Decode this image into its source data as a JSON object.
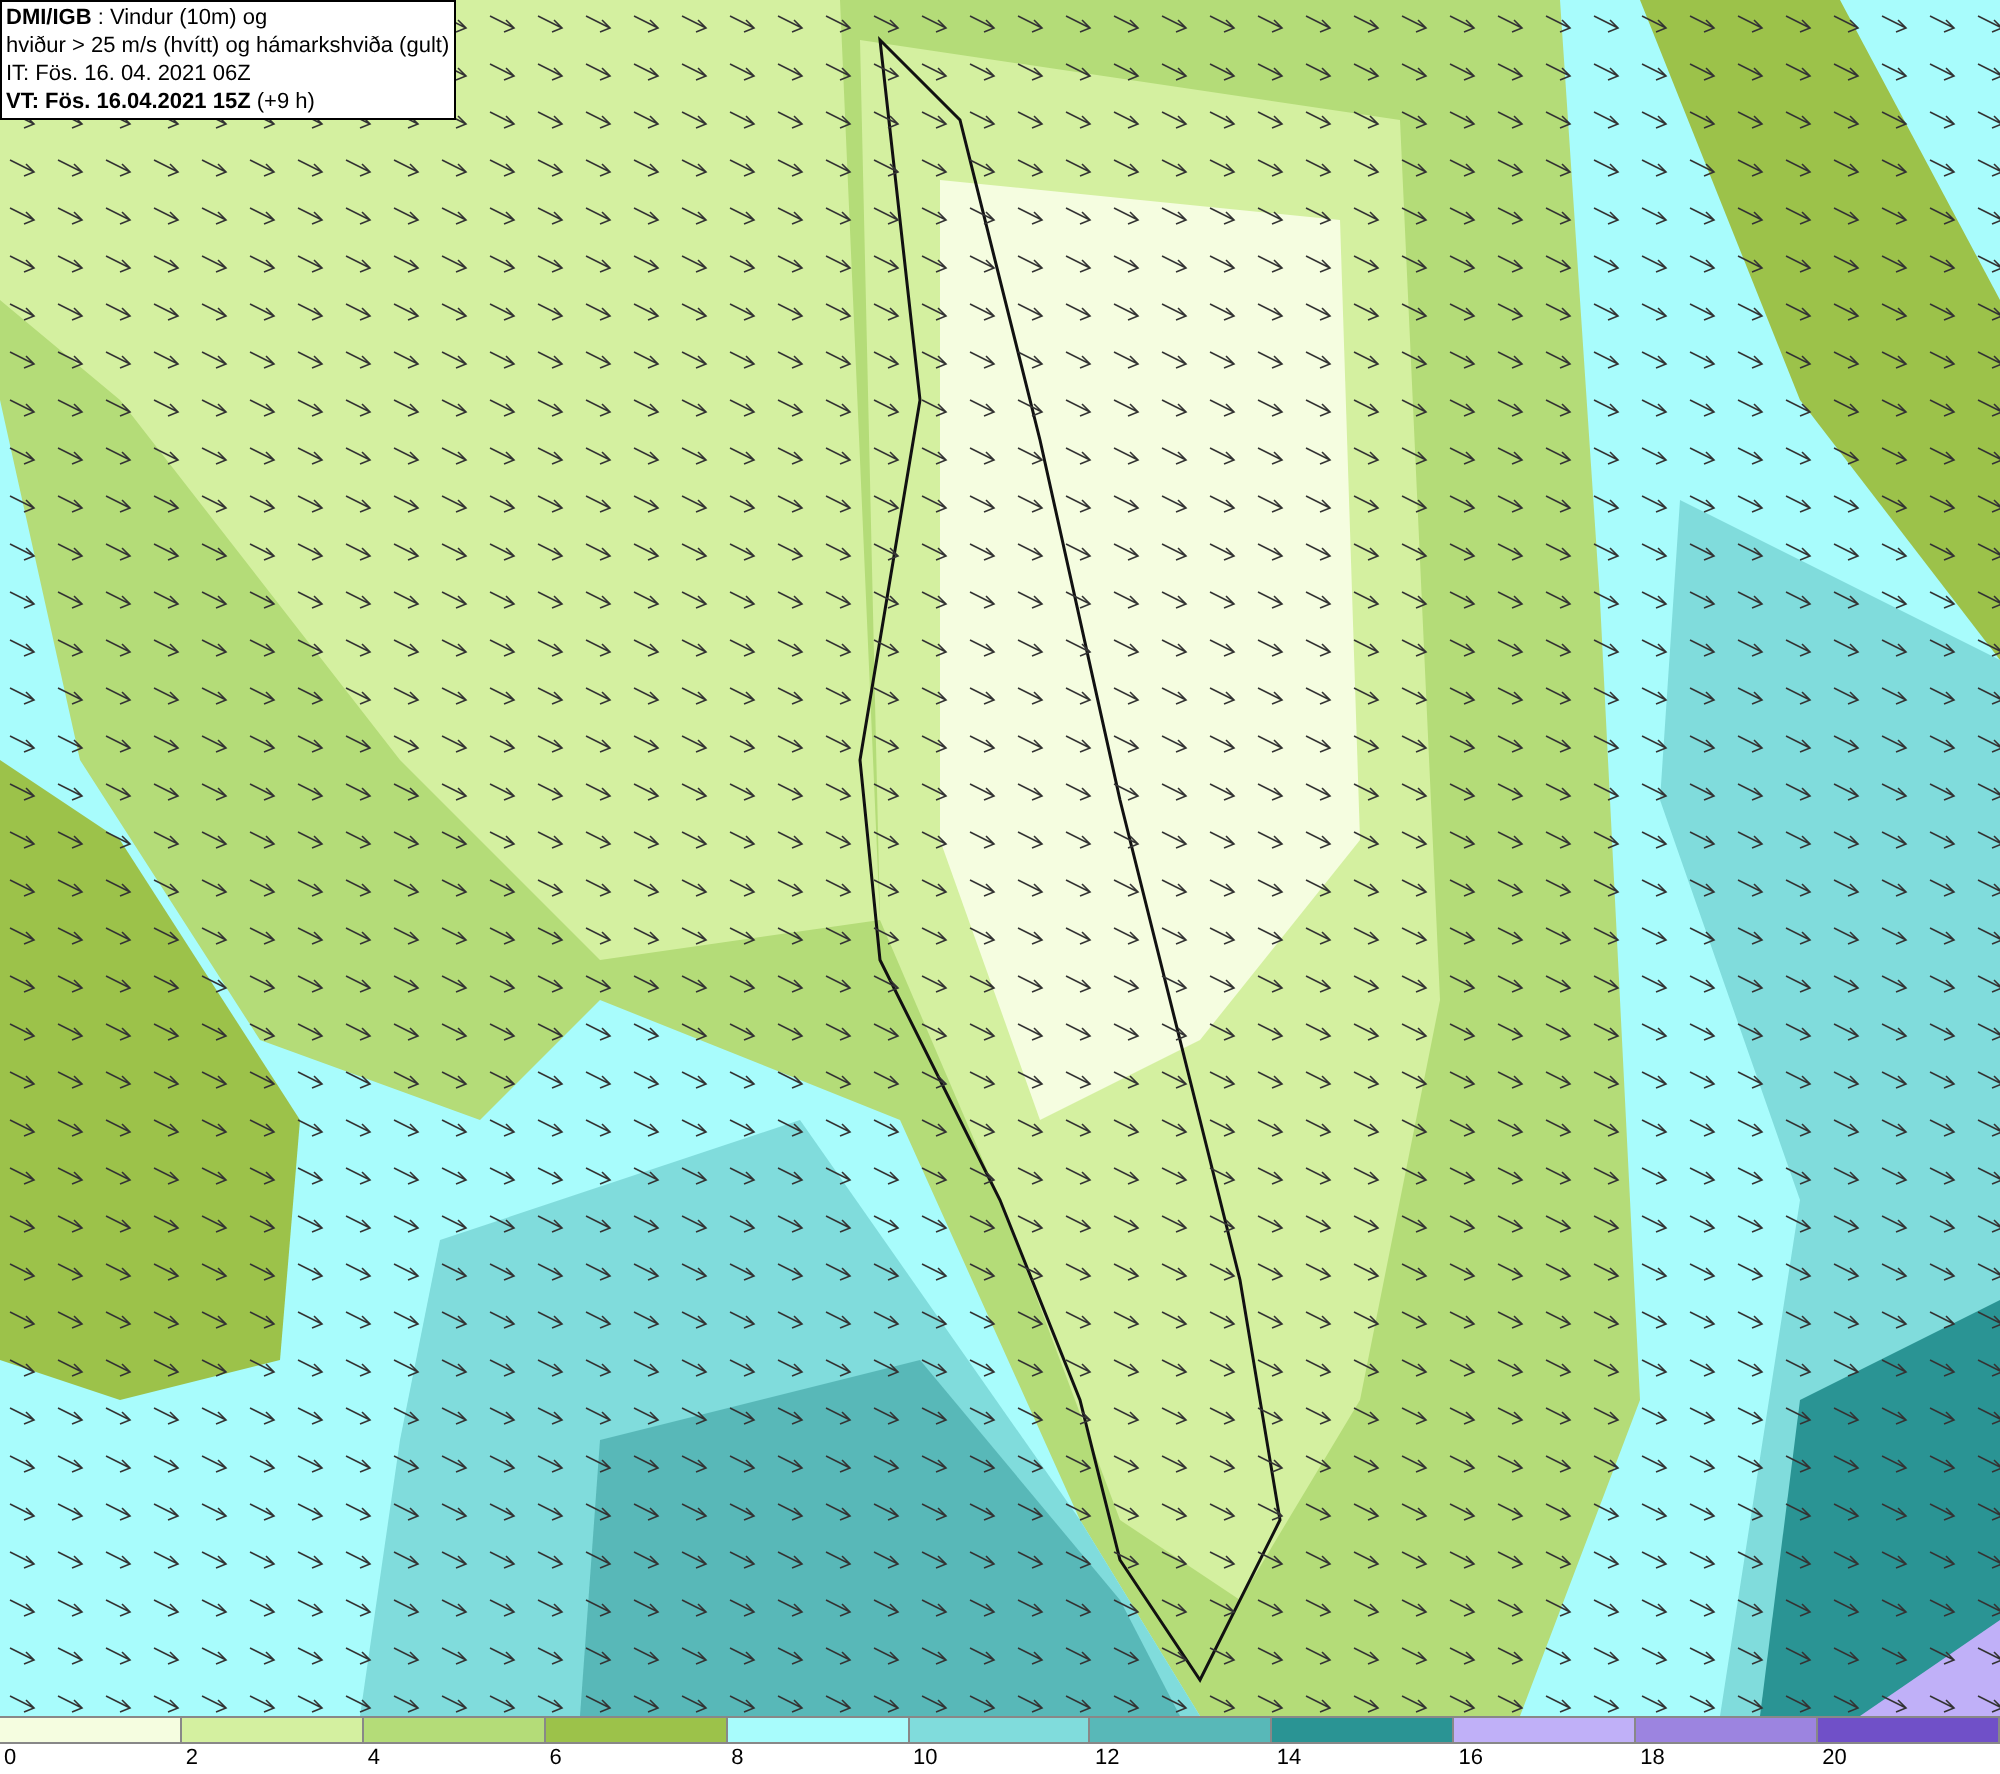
{
  "info_box": {
    "lines": [
      "**DMI/IGB** : Vindur (10m) og",
      "hviður > 25 m/s (hvítt) og hámarkshviða (gult)",
      "IT: Fös. 16. 04. 2021 06Z",
      "**VT: Fös. 16.04.2021 15Z** (+9 h)"
    ]
  },
  "colorbar": {
    "segments": [
      {
        "color": "#f5fde0"
      },
      {
        "color": "#d4f0a0"
      },
      {
        "color": "#b4dc78"
      },
      {
        "color": "#9cc24a"
      },
      {
        "color": "#a8fcfc"
      },
      {
        "color": "#80dcdc"
      },
      {
        "color": "#58b8b8"
      },
      {
        "color": "#2a9494"
      },
      {
        "color": "#c0b0f8"
      },
      {
        "color": "#9c84e0"
      },
      {
        "color": "#7050c8"
      }
    ],
    "ticks": [
      "0",
      "2",
      "4",
      "6",
      "8",
      "10",
      "12",
      "14",
      "16",
      "18",
      "20"
    ]
  }
}
